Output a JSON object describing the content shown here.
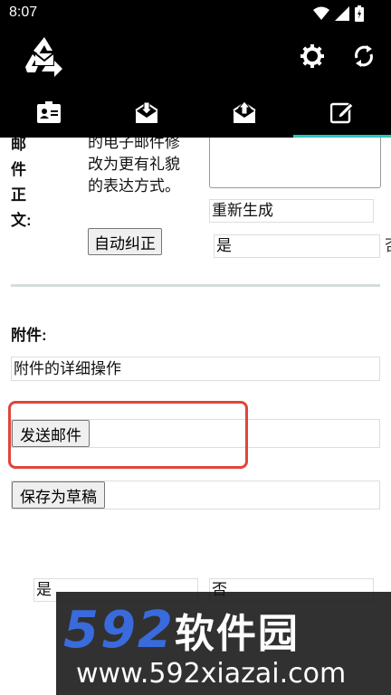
{
  "status_bar": {
    "time": "8:07"
  },
  "tabs": [
    {
      "icon": "contact-card-icon"
    },
    {
      "icon": "inbox-download-icon"
    },
    {
      "icon": "outbox-upload-icon"
    },
    {
      "icon": "compose-edit-icon",
      "active": true
    }
  ],
  "accent_color": "#31c3bf",
  "body_section": {
    "label": "邮件正文:",
    "description": "的电子邮件修改为更有礼貌的表达方式。",
    "regenerate_field": "重新生成",
    "auto_correct_button": "自动纠正",
    "yes_field": "是",
    "no_cut": "否"
  },
  "attachment_section": {
    "label": "附件:",
    "detail_field": "附件的详细操作"
  },
  "send_button": "发送邮件",
  "save_draft_button": "保存为草稿",
  "bottom_choices": {
    "yes": "是",
    "no": "否"
  },
  "watermark": {
    "brand_number": "592",
    "brand_name": "软件园",
    "url": "www.592xiazai.com"
  }
}
